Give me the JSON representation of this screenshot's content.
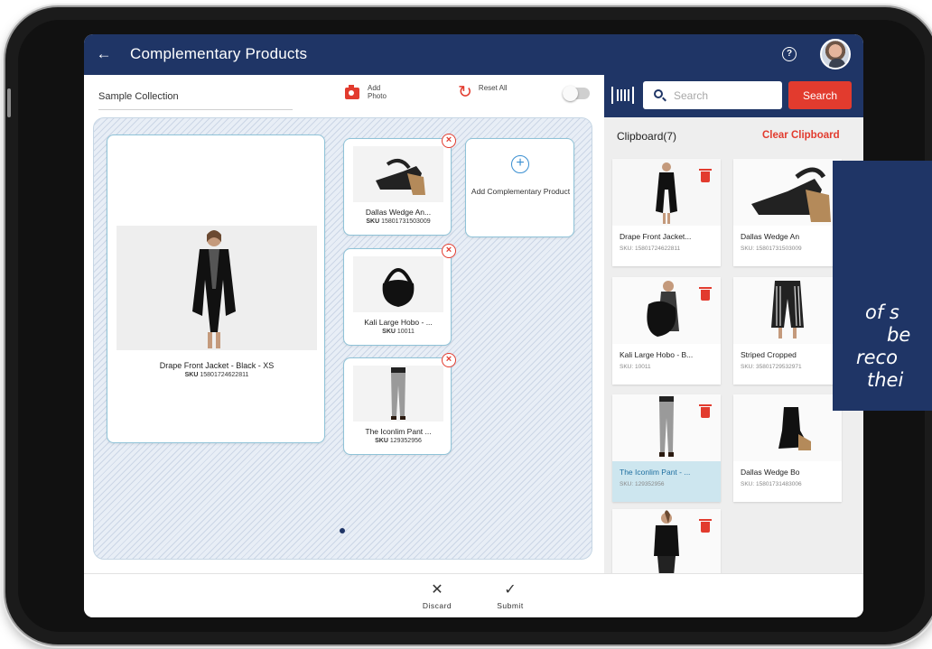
{
  "header": {
    "title": "Complementary Products"
  },
  "toolbar": {
    "collection_name": "Sample Collection",
    "add_photo_label": "Add Photo",
    "reset_all_label": "Reset All"
  },
  "main_product": {
    "name": "Drape Front Jacket - Black - XS",
    "sku_label": "SKU",
    "sku": "15801724622811"
  },
  "complementary": [
    {
      "name": "Dallas Wedge An...",
      "sku_label": "SKU",
      "sku": "15801731503009"
    },
    {
      "name": "Kali Large Hobo - ...",
      "sku_label": "SKU",
      "sku": "10011"
    },
    {
      "name": "The Iconlim Pant ...",
      "sku_label": "SKU",
      "sku": "129352956"
    }
  ],
  "add_card": {
    "label": "Add Complementary Product"
  },
  "search": {
    "placeholder": "Search",
    "button_label": "Search"
  },
  "clipboard": {
    "title": "Clipboard(7)",
    "clear_label": "Clear Clipboard",
    "items": [
      {
        "name": "Drape Front Jacket...",
        "sku": "SKU: 15801724622811"
      },
      {
        "name": "Dallas Wedge An",
        "sku": "SKU: 15801731503009"
      },
      {
        "name": "Kali Large Hobo - B...",
        "sku": "SKU: 10011"
      },
      {
        "name": "Striped Cropped",
        "sku": "SKU: 35801729532971"
      },
      {
        "name": "The Iconlim Pant - ...",
        "sku": "SKU: 129352956"
      },
      {
        "name": "Dallas Wedge Bo",
        "sku": "SKU: 15801731483006"
      },
      {
        "name": "",
        "sku": ""
      }
    ]
  },
  "actions": {
    "discard_label": "Discard",
    "submit_label": "Submit"
  },
  "overlay": {
    "line1": "of s",
    "line2": "be",
    "line3": "reco",
    "line4": "thei"
  },
  "colors": {
    "navy": "#1f3566",
    "accent_red": "#e23b2e",
    "selected_tile": "#cde6ef"
  }
}
